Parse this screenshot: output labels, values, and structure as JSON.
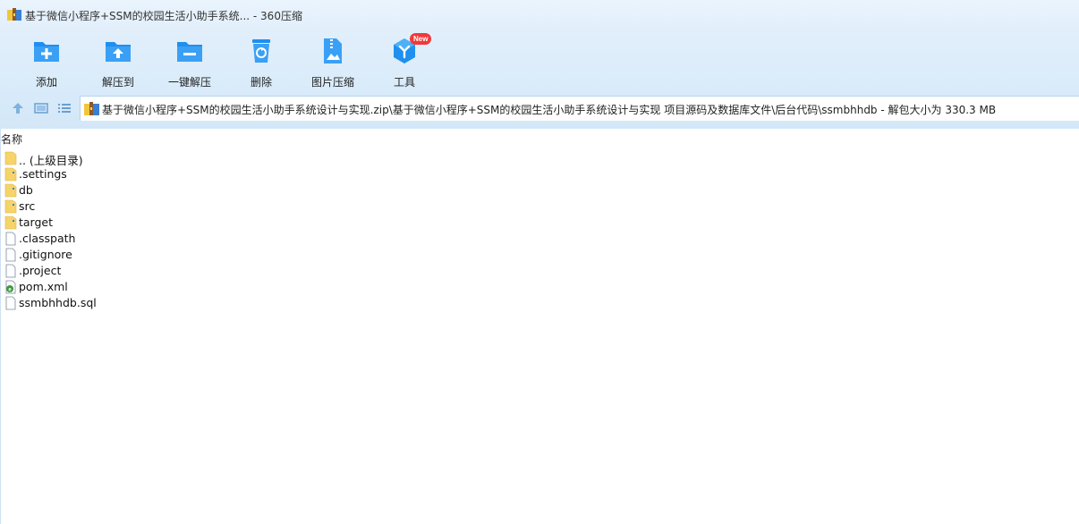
{
  "window": {
    "title": "基于微信小程序+SSM的校园生活小助手系统... - 360压缩"
  },
  "toolbar": {
    "items": [
      {
        "label": "添加",
        "icon": "add-folder-icon"
      },
      {
        "label": "解压到",
        "icon": "extract-to-icon"
      },
      {
        "label": "一键解压",
        "icon": "one-click-extract-icon"
      },
      {
        "label": "删除",
        "icon": "trash-icon"
      },
      {
        "label": "图片压缩",
        "icon": "image-compress-icon"
      },
      {
        "label": "工具",
        "icon": "tools-icon",
        "badge": "New"
      }
    ]
  },
  "navigation": {
    "path": "基于微信小程序+SSM的校园生活小助手系统设计与实现.zip\\基于微信小程序+SSM的校园生活小助手系统设计与实现 项目源码及数据库文件\\后台代码\\ssmbhhdb - 解包大小为 330.3 MB"
  },
  "filelist": {
    "header": "名称",
    "rows": [
      {
        "name": ".. (上级目录)",
        "type": "folder"
      },
      {
        "name": ".settings",
        "type": "folder"
      },
      {
        "name": "db",
        "type": "folder"
      },
      {
        "name": "src",
        "type": "folder"
      },
      {
        "name": "target",
        "type": "folder"
      },
      {
        "name": ".classpath",
        "type": "file"
      },
      {
        "name": ".gitignore",
        "type": "file"
      },
      {
        "name": ".project",
        "type": "file"
      },
      {
        "name": "pom.xml",
        "type": "xml"
      },
      {
        "name": "ssmbhhdb.sql",
        "type": "file"
      }
    ]
  },
  "colors": {
    "accent": "#1f8ff0",
    "folder": "#f7d46a",
    "badge": "#f03a3a"
  }
}
